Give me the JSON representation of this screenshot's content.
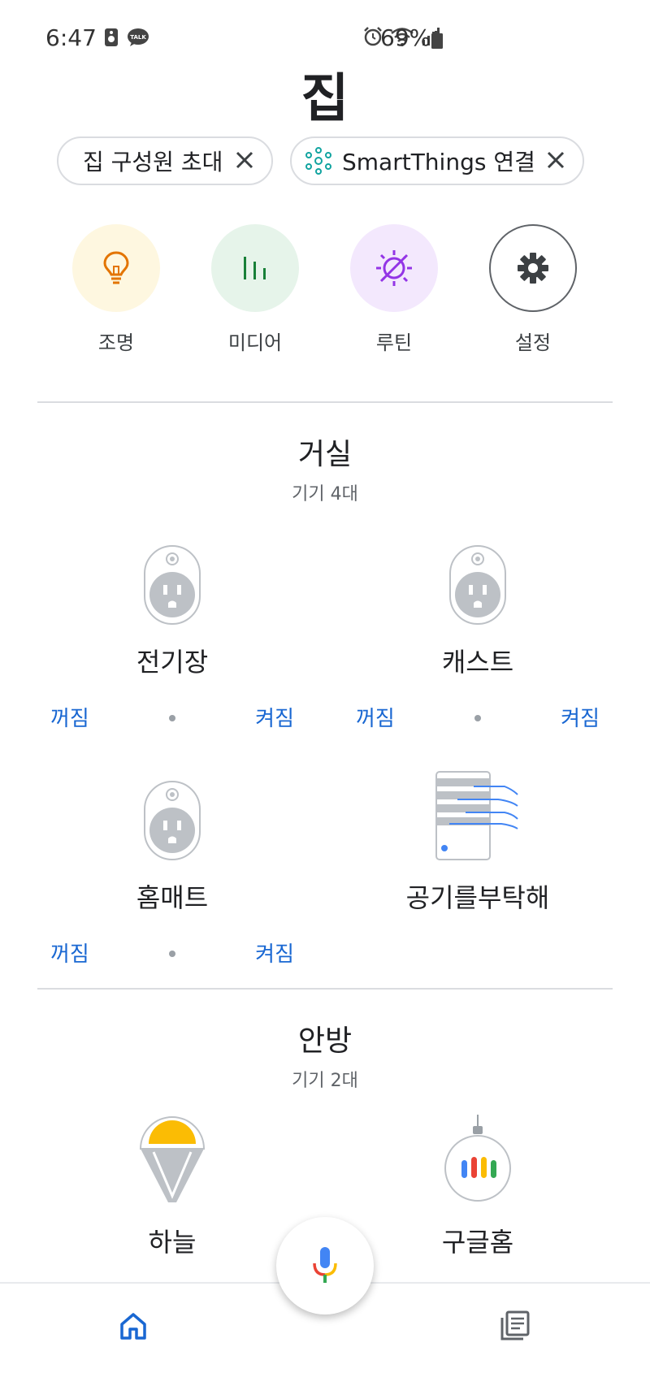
{
  "status_bar": {
    "time": "6:47",
    "battery": "69%",
    "icons": [
      "speaker-icon",
      "kakaotalk-icon",
      "alarm-icon",
      "wifi-icon",
      "signal-icon",
      "battery-icon"
    ],
    "kakaotalk_badge": "TALK"
  },
  "page": {
    "title": "집"
  },
  "chips": {
    "invite_label": "집 구성원 초대",
    "smartthings_label": "SmartThings 연결"
  },
  "quick_actions": [
    {
      "label": "조명",
      "icon": "lightbulb-icon",
      "bg": "#fef7e0",
      "color": "#e37400"
    },
    {
      "label": "미디어",
      "icon": "media-bars-icon",
      "bg": "#e6f4ea",
      "color": "#188038"
    },
    {
      "label": "루틴",
      "icon": "routine-sun-icon",
      "bg": "#f3e8fd",
      "color": "#9334e6"
    },
    {
      "label": "설정",
      "icon": "gear-icon",
      "bg": "#ffffff",
      "color": "#3c4043"
    }
  ],
  "rooms": [
    {
      "name": "거실",
      "count": "기기 4대",
      "devices": [
        {
          "name": "전기장",
          "icon": "smart-plug-icon",
          "off": "꺼짐",
          "on": "켜짐"
        },
        {
          "name": "캐스트",
          "icon": "smart-plug-icon",
          "off": "꺼짐",
          "on": "켜짐"
        },
        {
          "name": "홈매트",
          "icon": "smart-plug-icon",
          "off": "꺼짐",
          "on": "켜짐"
        },
        {
          "name": "공기를부탁해",
          "icon": "air-purifier-icon"
        }
      ]
    },
    {
      "name": "안방",
      "count": "기기 2대",
      "devices": [
        {
          "name": "하늘",
          "icon": "light-bulb-device-icon"
        },
        {
          "name": "구글홈",
          "icon": "google-home-speaker-icon"
        }
      ]
    }
  ],
  "bottom_nav": {
    "items": [
      "home-icon",
      "feed-icon"
    ],
    "mic": "mic-icon"
  },
  "colors": {
    "accent": "#1967d2",
    "divider": "#dadce0",
    "plug_gray": "#bdc1c6"
  }
}
